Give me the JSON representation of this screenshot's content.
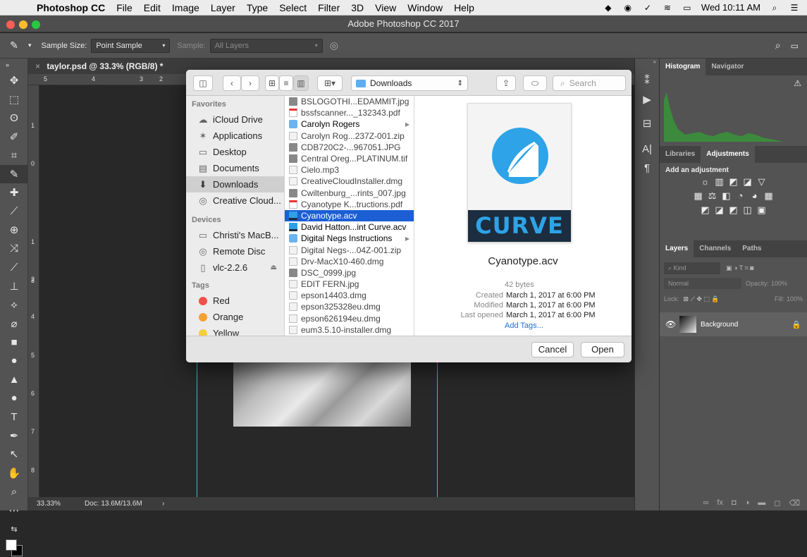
{
  "menubar": {
    "apple": "",
    "app_name": "Photoshop CC",
    "items": [
      "File",
      "Edit",
      "Image",
      "Layer",
      "Type",
      "Select",
      "Filter",
      "3D",
      "View",
      "Window",
      "Help"
    ],
    "clock": "Wed 10:11 AM"
  },
  "ps_title": "Adobe Photoshop CC 2017",
  "options": {
    "sample_size_label": "Sample Size:",
    "sample_size_value": "Point Sample",
    "sample_label": "Sample:",
    "sample_value": "All Layers"
  },
  "document": {
    "tab_title": "taylor.psd @ 33.3% (RGB/8) *",
    "ruler_top": [
      "5",
      "4",
      "3",
      "2"
    ],
    "ruler_left": [
      "1",
      "0",
      "1",
      "2",
      "3",
      "4",
      "5",
      "6",
      "7",
      "8"
    ],
    "zoom": "33.33%",
    "doc_size": "Doc: 13.6M/13.6M"
  },
  "panels": {
    "top_tabs": [
      "Histogram",
      "Navigator"
    ],
    "mid_tabs": [
      "Libraries",
      "Adjustments"
    ],
    "add_adjustment": "Add an adjustment",
    "layer_tabs": [
      "Layers",
      "Channels",
      "Paths"
    ],
    "kind_label": "Kind",
    "blend_mode": "Normal",
    "opacity_label": "Opacity:",
    "opacity_value": "100%",
    "lock_label": "Lock:",
    "fill_label": "Fill:",
    "fill_value": "100%",
    "layer_name": "Background"
  },
  "dialog": {
    "location": "Downloads",
    "search_placeholder": "Search",
    "sidebar": {
      "favorites_heading": "Favorites",
      "favorites": [
        {
          "label": "iCloud Drive",
          "icon": "cloud-icon"
        },
        {
          "label": "Applications",
          "icon": "applications-icon"
        },
        {
          "label": "Desktop",
          "icon": "desktop-icon"
        },
        {
          "label": "Documents",
          "icon": "documents-icon"
        },
        {
          "label": "Downloads",
          "icon": "downloads-icon"
        },
        {
          "label": "Creative Cloud...",
          "icon": "creative-cloud-icon"
        }
      ],
      "devices_heading": "Devices",
      "devices": [
        "Christi's MacB...",
        "Remote Disc",
        "vlc-2.2.6"
      ],
      "tags_heading": "Tags",
      "tags": [
        {
          "label": "Red",
          "color": "#f0504a"
        },
        {
          "label": "Orange",
          "color": "#f5a033"
        },
        {
          "label": "Yellow",
          "color": "#f4cf3c"
        }
      ]
    },
    "files": [
      {
        "name": "BSLOGOTHI...EDAMMIT.jpg",
        "kind": "img"
      },
      {
        "name": "bssfscanner..._132343.pdf",
        "kind": "pdf"
      },
      {
        "name": "Carolyn Rogers",
        "kind": "folder"
      },
      {
        "name": "Carolyn Rog...237Z-001.zip",
        "kind": "doc"
      },
      {
        "name": "CDB720C2-...967051.JPG",
        "kind": "img"
      },
      {
        "name": "Central Oreg...PLATINUM.tif",
        "kind": "img"
      },
      {
        "name": "Cielo.mp3",
        "kind": "doc"
      },
      {
        "name": "CreativeCloudInstaller.dmg",
        "kind": "doc"
      },
      {
        "name": "Cwiltenburg_...rints_007.jpg",
        "kind": "img"
      },
      {
        "name": "Cyanotype K...tructions.pdf",
        "kind": "pdf"
      },
      {
        "name": "Cyanotype.acv",
        "kind": "curve"
      },
      {
        "name": "David Hatton...int Curve.acv",
        "kind": "curve"
      },
      {
        "name": "Digital Negs Instructions",
        "kind": "folder"
      },
      {
        "name": "Digital Negs-...04Z-001.zip",
        "kind": "doc"
      },
      {
        "name": "Drv-MacX10-460.dmg",
        "kind": "doc"
      },
      {
        "name": "DSC_0999.jpg",
        "kind": "img"
      },
      {
        "name": "EDIT FERN.jpg",
        "kind": "img"
      },
      {
        "name": "epson14403.dmg",
        "kind": "doc"
      },
      {
        "name": "epson325328eu.dmg",
        "kind": "doc"
      },
      {
        "name": "epson626194eu.dmg",
        "kind": "doc"
      },
      {
        "name": "eum3.5.10-installer.dmg",
        "kind": "doc"
      }
    ],
    "preview": {
      "icon_text": "CURVE",
      "filename": "Cyanotype.acv",
      "size": "42 bytes",
      "created_label": "Created",
      "created": "March 1, 2017 at 6:00 PM",
      "modified_label": "Modified",
      "modified": "March 1, 2017 at 6:00 PM",
      "opened_label": "Last opened",
      "opened": "March 1, 2017 at 6:00 PM",
      "add_tags": "Add Tags..."
    },
    "cancel": "Cancel",
    "open": "Open"
  }
}
